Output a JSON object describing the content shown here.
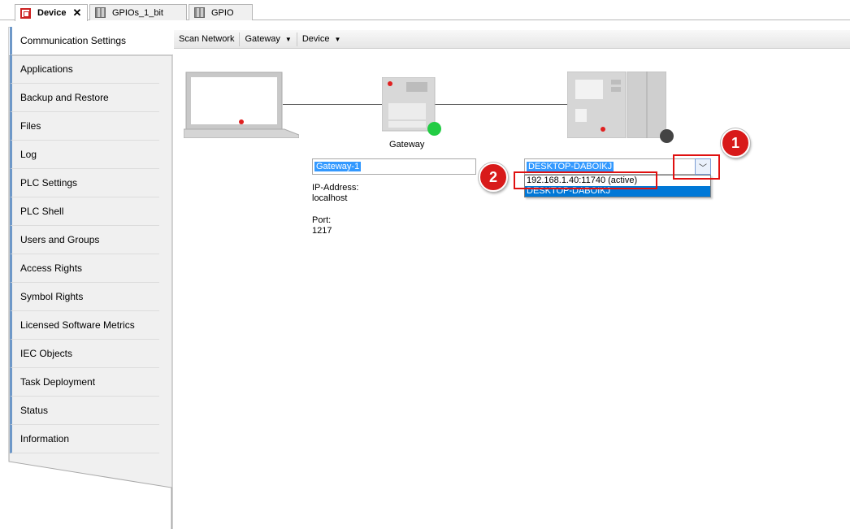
{
  "tabs": [
    {
      "label": "Device",
      "icon": "device-icon",
      "active": true,
      "closable": true
    },
    {
      "label": "GPIOs_1_bit",
      "icon": "module-icon"
    },
    {
      "label": "GPIO",
      "icon": "module-icon"
    }
  ],
  "sidebar": {
    "items": [
      {
        "label": "Communication Settings",
        "active": true
      },
      {
        "label": "Applications"
      },
      {
        "label": "Backup and Restore"
      },
      {
        "label": "Files"
      },
      {
        "label": "Log"
      },
      {
        "label": "PLC Settings"
      },
      {
        "label": "PLC Shell"
      },
      {
        "label": "Users and Groups"
      },
      {
        "label": "Access Rights"
      },
      {
        "label": "Symbol Rights"
      },
      {
        "label": "Licensed Software Metrics"
      },
      {
        "label": "IEC Objects"
      },
      {
        "label": "Task Deployment"
      },
      {
        "label": "Status"
      },
      {
        "label": "Information"
      }
    ]
  },
  "toolbar": {
    "scan_network": "Scan Network",
    "gateway": "Gateway",
    "device": "Device"
  },
  "diagram": {
    "gateway_caption": "Gateway",
    "gateway_field": "Gateway-1",
    "ip_label": "IP-Address:",
    "ip_value": "localhost",
    "port_label": "Port:",
    "port_value": "1217",
    "device_field": "DESKTOP-DABOIKJ",
    "dropdown_options": [
      "192.168.1.40:11740 (active)",
      "DESKTOP-DABOIKJ"
    ],
    "gateway_status_color": "#22cc44",
    "device_status_color": "#444444"
  },
  "annotations": {
    "badge1": "1",
    "badge2": "2",
    "highlight_color": "#e01010"
  }
}
